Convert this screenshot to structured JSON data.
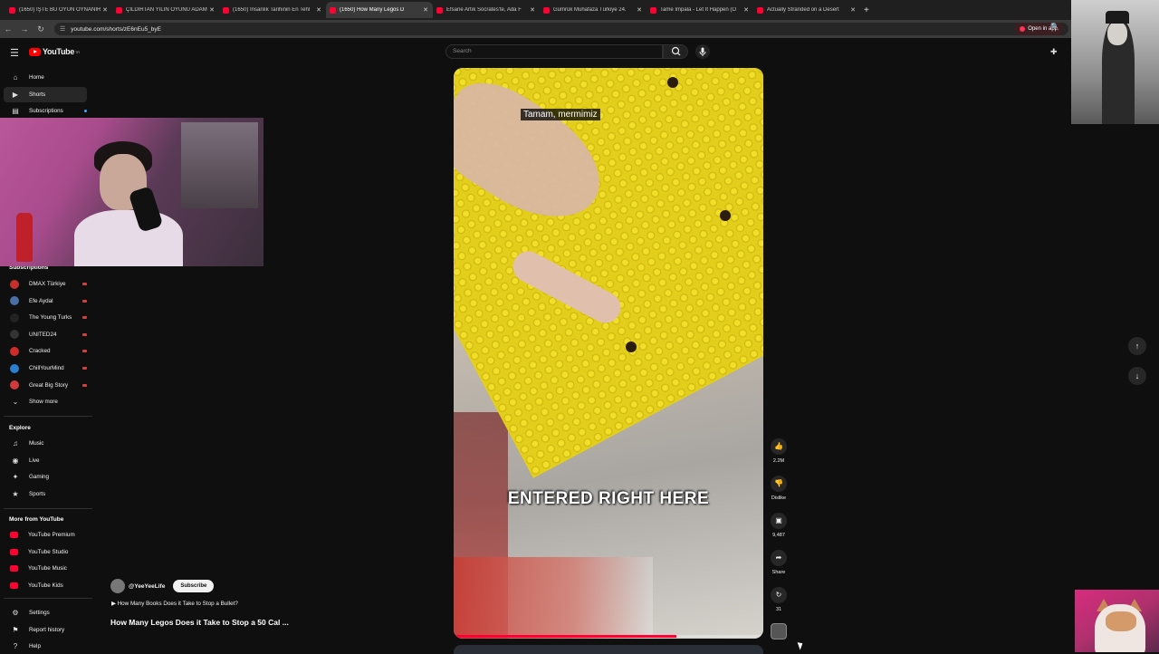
{
  "browser": {
    "tabs": [
      {
        "title": "(1650) İŞTE BU OYUN OYNANIR"
      },
      {
        "title": "ÇILDIRTAN YILIN OYUNU ADAM"
      },
      {
        "title": "(1650) İnsanlık Tarihinin En Tehl"
      },
      {
        "title": "(1650) How Many Legos D",
        "active": true
      },
      {
        "title": "Efsane Artık Socrates'te, Ada F"
      },
      {
        "title": "Gümrük Muhafaza Türkiye 24."
      },
      {
        "title": "Tame Impala - Let It Happen (O"
      },
      {
        "title": "Actually Stranded on a Desert"
      }
    ],
    "url": "youtube.com/shorts/zE6nEu5_byE",
    "open_in_app": "Open in app"
  },
  "header": {
    "logo_text": "YouTube",
    "logo_sup": "TR",
    "search_placeholder": "Search"
  },
  "sidebar": {
    "main": [
      {
        "label": "Home",
        "icon": "home-icon"
      },
      {
        "label": "Shorts",
        "icon": "shorts-icon",
        "active": true
      },
      {
        "label": "Subscriptions",
        "icon": "subscriptions-icon"
      }
    ],
    "subscriptions_heading": "Subscriptions",
    "channels": [
      {
        "label": "DMAX Türkiye",
        "color": "#c4302b"
      },
      {
        "label": "Efe Aydal",
        "color": "#4a6fa5"
      },
      {
        "label": "The Young Turks",
        "color": "#222222"
      },
      {
        "label": "UNITED24",
        "color": "#333333"
      },
      {
        "label": "Cracked",
        "color": "#d02a2a"
      },
      {
        "label": "ChillYourMind",
        "color": "#2a7fd0"
      },
      {
        "label": "Great Big Story",
        "color": "#d03a3a"
      }
    ],
    "show_more": "Show more",
    "explore_heading": "Explore",
    "explore": [
      {
        "label": "Music",
        "icon": "music-icon"
      },
      {
        "label": "Live",
        "icon": "live-icon"
      },
      {
        "label": "Gaming",
        "icon": "gaming-icon"
      },
      {
        "label": "Sports",
        "icon": "trophy-icon"
      }
    ],
    "more_heading": "More from YouTube",
    "more": [
      {
        "label": "YouTube Premium"
      },
      {
        "label": "YouTube Studio"
      },
      {
        "label": "YouTube Music"
      },
      {
        "label": "YouTube Kids"
      }
    ],
    "footer": [
      {
        "label": "Settings",
        "icon": "gear-icon"
      },
      {
        "label": "Report history",
        "icon": "flag-icon"
      },
      {
        "label": "Help",
        "icon": "help-icon"
      }
    ]
  },
  "short": {
    "subtitle": "Tamam, mermimiz",
    "caption": "ENTERED RIGHT HERE",
    "progress": 0.72,
    "channel": "@YeeYeeLife",
    "subscribe": "Subscribe",
    "related": "How Many Books Does it Take to Stop a Bullet?",
    "title": "How Many Legos Does it Take to Stop a 50 Cal ..."
  },
  "actions": {
    "likes": "2.2M",
    "dislike": "Dislike",
    "comments": "9,487",
    "share": "Share",
    "remix": "31"
  }
}
